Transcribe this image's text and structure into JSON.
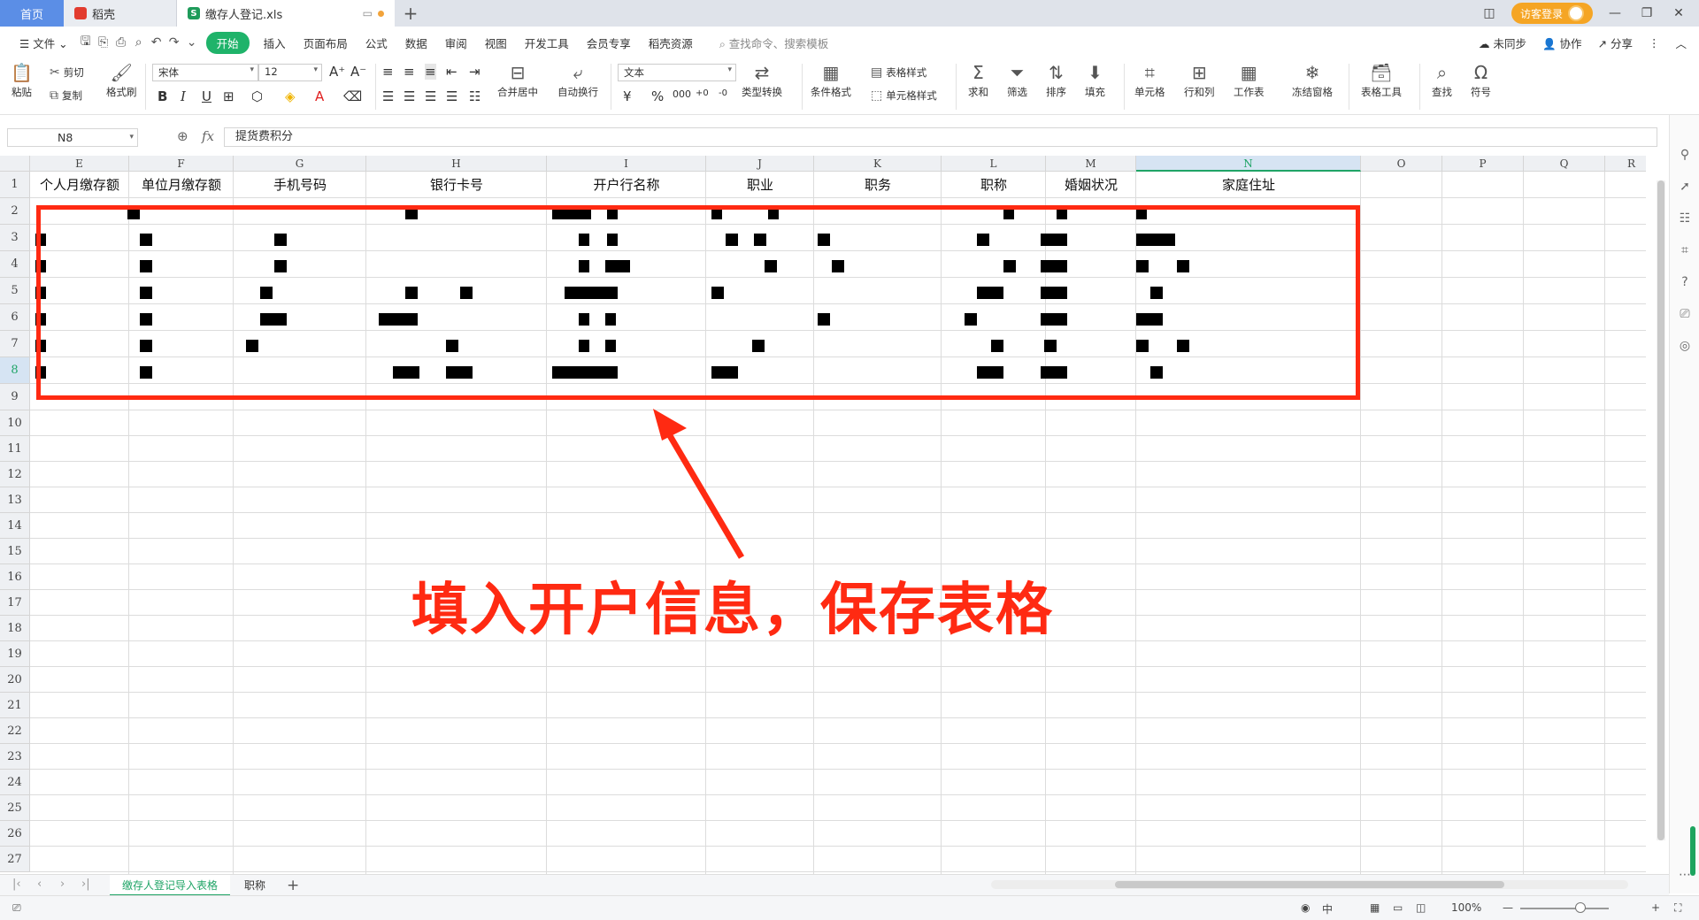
{
  "titlebar": {
    "tabs": [
      {
        "label": "首页"
      },
      {
        "label": "稻壳"
      },
      {
        "label": "缴存人登记.xls"
      }
    ],
    "visitor_login": "访客登录"
  },
  "menu": {
    "file": "文件",
    "items": [
      "开始",
      "插入",
      "页面布局",
      "公式",
      "数据",
      "审阅",
      "视图",
      "开发工具",
      "会员专享",
      "稻壳资源"
    ],
    "search_placeholder": "查找命令、搜索模板",
    "right": [
      "未同步",
      "协作",
      "分享"
    ]
  },
  "ribbon": {
    "paste": "粘贴",
    "cut": "剪切",
    "copy": "复制",
    "format_painter": "格式刷",
    "font_name": "宋体",
    "font_size": "12",
    "merge_center": "合并居中",
    "wrap_text": "自动换行",
    "number_format": "文本",
    "type_convert": "类型转换",
    "cond_format": "条件格式",
    "table_style": "表格样式",
    "cell_style": "单元格样式",
    "sum": "求和",
    "filter": "筛选",
    "sort": "排序",
    "fill": "填充",
    "cell": "单元格",
    "row_col": "行和列",
    "worksheet": "工作表",
    "freeze": "冻结窗格",
    "table_tools": "表格工具",
    "find": "查找",
    "symbol": "符号"
  },
  "formula_bar": {
    "cell_ref": "N8",
    "fx": "fx",
    "content": "提货费积分"
  },
  "grid": {
    "columns": [
      "E",
      "F",
      "G",
      "H",
      "I",
      "J",
      "K",
      "L",
      "M",
      "N",
      "O",
      "P",
      "Q",
      "R"
    ],
    "selected_column": "N",
    "rows": [
      "1",
      "2",
      "3",
      "4",
      "5",
      "6",
      "7",
      "8",
      "9",
      "10",
      "11",
      "12",
      "13",
      "14",
      "15",
      "16",
      "17",
      "18",
      "19",
      "20",
      "21",
      "22",
      "23",
      "24",
      "25",
      "26",
      "27"
    ],
    "selected_row": "8",
    "headers": [
      "个人月缴存额",
      "单位月缴存额",
      "手机号码",
      "银行卡号",
      "开户行名称",
      "职业",
      "职务",
      "职称",
      "婚姻状况",
      "家庭住址"
    ]
  },
  "annotation": "填入开户信息，保存表格",
  "sheets": {
    "tabs": [
      "缴存人登记导入表格",
      "职称"
    ],
    "active": "缴存人登记导入表格"
  },
  "status": {
    "input_method": "中",
    "zoom": "100%"
  },
  "colors": {
    "accent_green": "#1fa466",
    "annotation_red": "#ff2a12",
    "home_tab_blue": "#5b8ee6"
  }
}
